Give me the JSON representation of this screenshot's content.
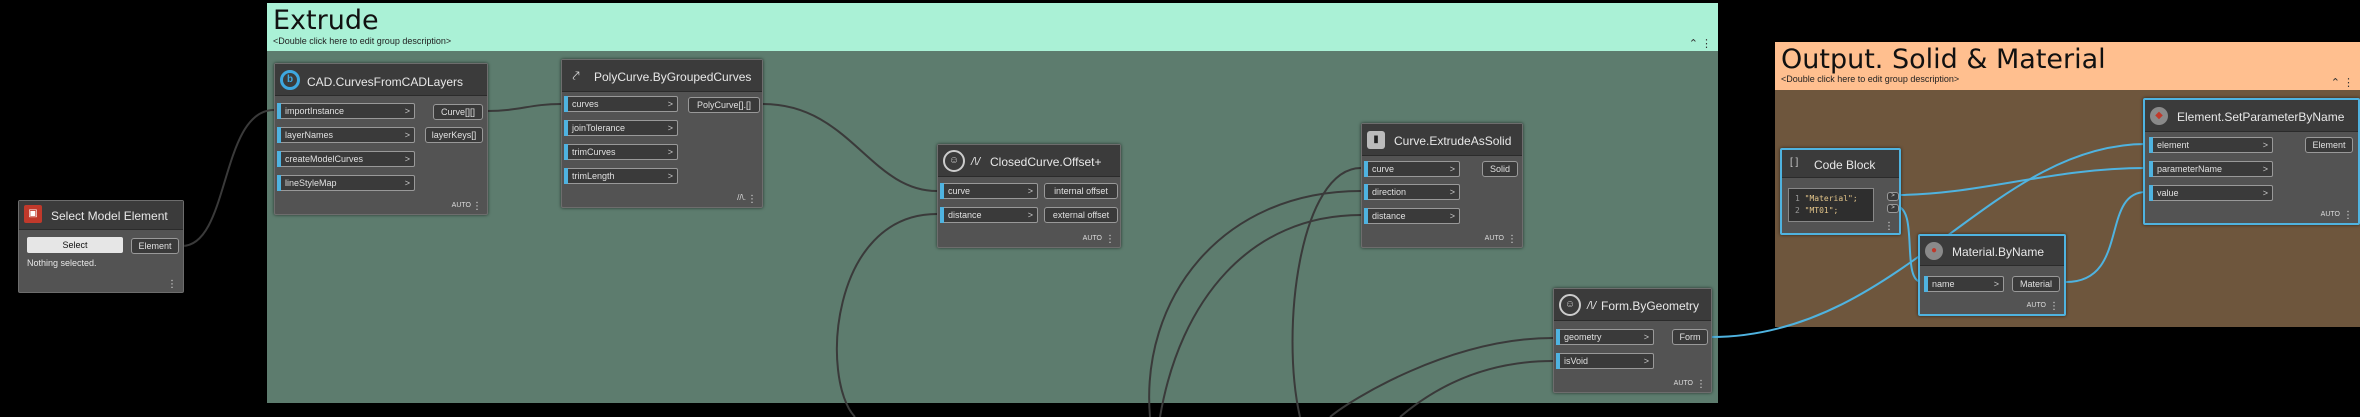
{
  "groups": {
    "extrude": {
      "title": "Extrude",
      "description": "<Double click here to edit group description>",
      "header_color": "#aaf1d6",
      "body_color": "#5d7c6e",
      "controls": "⌃ ⋮"
    },
    "output": {
      "title": "Output. Solid & Material",
      "description": "<Double click here to edit group description>",
      "header_color": "#ffbf8f",
      "body_color": "#6e563d",
      "controls": "⌃ ⋮"
    }
  },
  "nodes": {
    "select_model_element": {
      "title": "Select Model Element",
      "icon": "select-icon",
      "button_label": "Select",
      "output": "Element",
      "status": "Nothing selected."
    },
    "cad_curves": {
      "title": "CAD.CurvesFromCADLayers",
      "icon": "cad-icon",
      "inputs": [
        "importInstance",
        "layerNames",
        "createModelCurves",
        "lineStyleMap"
      ],
      "outputs": [
        "Curve[][]",
        "layerKeys[]"
      ],
      "lacing": "AUTO"
    },
    "polycurve": {
      "title": "PolyCurve.ByGroupedCurves",
      "icon": "polycurve-icon",
      "inputs": [
        "curves",
        "joinTolerance",
        "trimCurves",
        "trimLength"
      ],
      "outputs": [
        "PolyCurve[].[]"
      ],
      "lacing": "//\\."
    },
    "closed_curve_offset": {
      "title": "ClosedCurve.Offset+",
      "icon": "package-icon",
      "inputs": [
        "curve",
        "distance"
      ],
      "outputs": [
        "internal offset",
        "external offset"
      ],
      "lacing": "AUTO"
    },
    "curve_extrude": {
      "title": "Curve.ExtrudeAsSolid",
      "icon": "extrude-icon",
      "inputs": [
        "curve",
        "direction",
        "distance"
      ],
      "outputs": [
        "Solid"
      ],
      "lacing": "AUTO"
    },
    "form_by_geometry": {
      "title": "Form.ByGeometry",
      "icon": "package-icon",
      "inputs": [
        "geometry",
        "isVoid"
      ],
      "outputs": [
        "Form"
      ],
      "lacing": "AUTO"
    },
    "code_block": {
      "title": "Code Block",
      "icon": "code-block-icon",
      "lines": [
        {
          "num": "1",
          "text": "\"Material\";"
        },
        {
          "num": "2",
          "text": "\"MT01\";"
        }
      ],
      "outputs": [
        ">",
        ">"
      ]
    },
    "material_by_name": {
      "title": "Material.ByName",
      "icon": "material-icon",
      "inputs": [
        "name"
      ],
      "outputs": [
        "Material"
      ],
      "lacing": "AUTO"
    },
    "set_parameter": {
      "title": "Element.SetParameterByName",
      "icon": "revit-icon",
      "inputs": [
        "element",
        "parameterName",
        "value"
      ],
      "outputs": [
        "Element"
      ],
      "lacing": "AUTO"
    }
  },
  "colors": {
    "wire": "#3a3a3a",
    "wire_selected": "#4fb3e0",
    "accent": "#4fb3e0"
  }
}
